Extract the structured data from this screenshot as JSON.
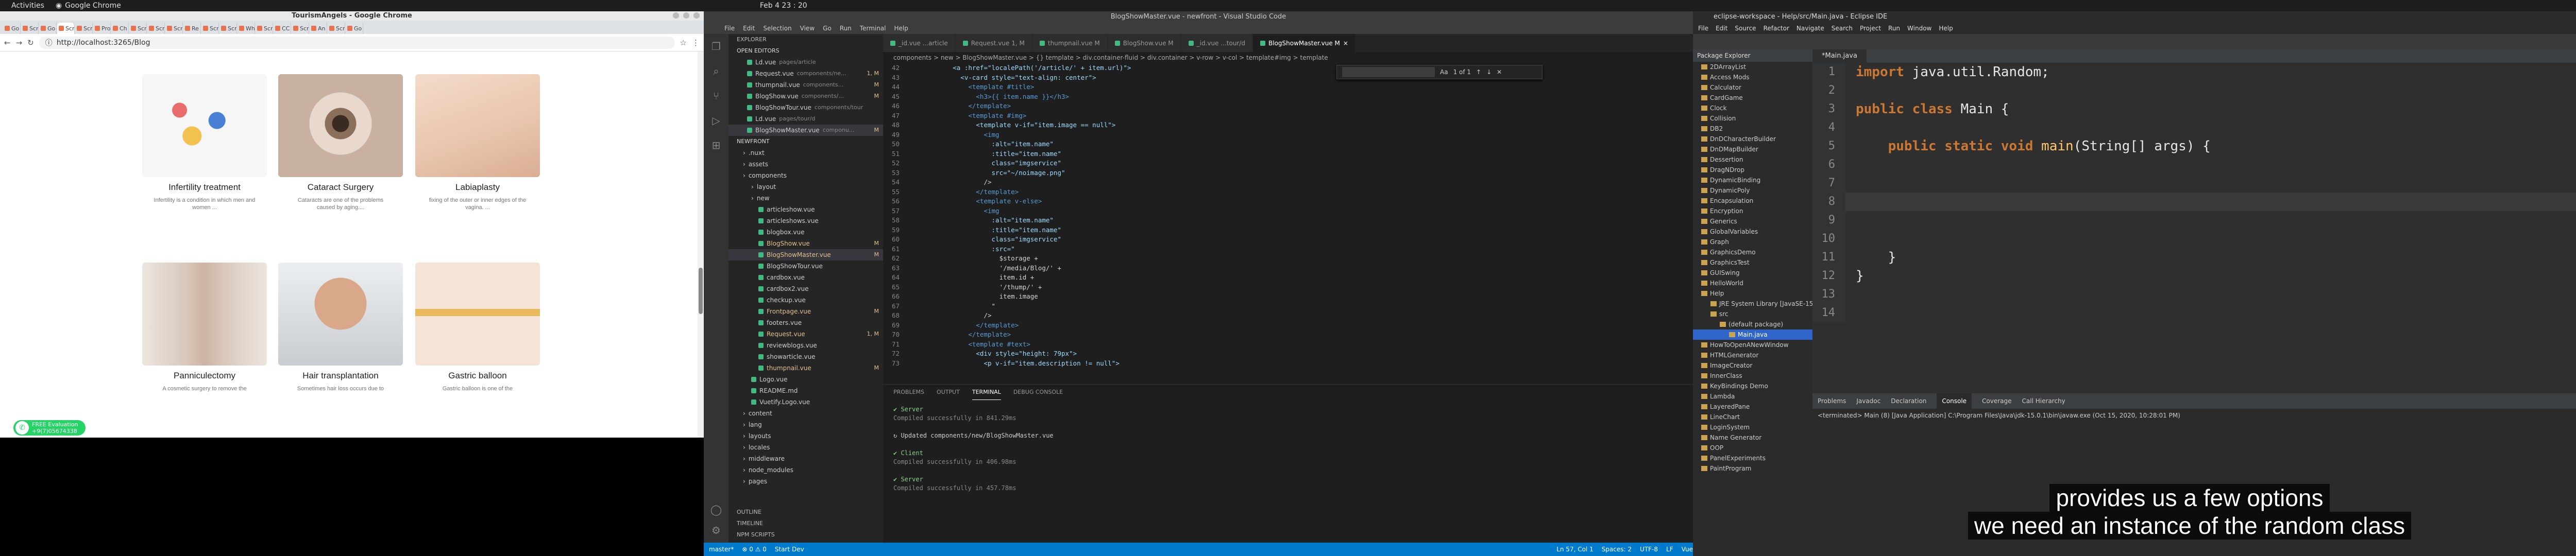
{
  "system_bar": {
    "activities": "Activities",
    "app": "Google Chrome",
    "clock": "Feb 4 23 : 20"
  },
  "chrome": {
    "window_title": "TourismAngels - Google Chrome",
    "tabs": [
      "Go",
      "Scr",
      "Go",
      "Scr",
      "Scr",
      "Pro",
      "Ch",
      "Scr",
      "Scr",
      "Scr",
      "Re",
      "Scr",
      "Scr",
      "Wh",
      "Scr",
      "CC",
      "Scr",
      "An",
      "Scr",
      "Go"
    ],
    "active_tab_index": 3,
    "url": "http://localhost:3265/Blog",
    "cards": [
      {
        "title": "Infertility treatment",
        "desc": "Infertility is a condition in which men and women ...",
        "img": "pills"
      },
      {
        "title": "Cataract Surgery",
        "desc": "Cataracts are one of the problems caused by aging....",
        "img": "eye"
      },
      {
        "title": "Labiaplasty",
        "desc": "fixing of the outer or inner edges of the vagina. ...",
        "img": "skin"
      },
      {
        "title": "Panniculectomy",
        "desc": "A cosmetic surgery to remove the",
        "img": "waist"
      },
      {
        "title": "Hair transplantation",
        "desc": "Sometimes hair loss occurs due to",
        "img": "man"
      },
      {
        "title": "Gastric balloon",
        "desc": "Gastric balloon is one of the",
        "img": "tape"
      }
    ],
    "whatsapp": {
      "line1": "FREE Evaluation",
      "line2": "+9(7)05674338"
    }
  },
  "vscode": {
    "window_title": "BlogShowMaster.vue - newfront - Visual Studio Code",
    "menu": [
      "File",
      "Edit",
      "Selection",
      "View",
      "Go",
      "Run",
      "Terminal",
      "Help"
    ],
    "sidebar": {
      "explorer_label": "EXPLORER",
      "open_editors_label": "OPEN EDITORS",
      "open_editors": [
        {
          "name": "Ld.vue",
          "path": "pages/article",
          "mod": ""
        },
        {
          "name": "Request.vue",
          "path": "components/ne...",
          "mod": "1, M"
        },
        {
          "name": "thumpnail.vue",
          "path": "components...",
          "mod": "M"
        },
        {
          "name": "BlogShow.vue",
          "path": "components/...",
          "mod": "M"
        },
        {
          "name": "BlogShowTour.vue",
          "path": "components/tour",
          "mod": ""
        },
        {
          "name": "Ld.vue",
          "path": "pages/tour/d",
          "mod": ""
        },
        {
          "name": "BlogShowMaster.vue",
          "path": "componu...",
          "mod": "M"
        }
      ],
      "project_label": "NEWFRONT",
      "tree": [
        {
          "name": ".nuxt",
          "mod": ""
        },
        {
          "name": "assets",
          "mod": ""
        },
        {
          "name": "components",
          "mod": ""
        },
        {
          "name": "layout",
          "mod": ""
        },
        {
          "name": "new",
          "mod": ""
        },
        {
          "name": "articleshow.vue",
          "mod": ""
        },
        {
          "name": "articleshows.vue",
          "mod": ""
        },
        {
          "name": "blogbox.vue",
          "mod": ""
        },
        {
          "name": "BlogShow.vue",
          "mod": "M"
        },
        {
          "name": "BlogShowMaster.vue",
          "mod": "M"
        },
        {
          "name": "BlogShowTour.vue",
          "mod": ""
        },
        {
          "name": "cardbox.vue",
          "mod": ""
        },
        {
          "name": "cardbox2.vue",
          "mod": ""
        },
        {
          "name": "checkup.vue",
          "mod": ""
        },
        {
          "name": "Frontpage.vue",
          "mod": "M"
        },
        {
          "name": "footers.vue",
          "mod": ""
        },
        {
          "name": "Request.vue",
          "mod": "1, M"
        },
        {
          "name": "reviewblogs.vue",
          "mod": ""
        },
        {
          "name": "showarticle.vue",
          "mod": ""
        },
        {
          "name": "thumpnail.vue",
          "mod": "M"
        },
        {
          "name": "Logo.vue",
          "mod": ""
        },
        {
          "name": "README.md",
          "mod": ""
        },
        {
          "name": "Vuetify.Logo.vue",
          "mod": ""
        },
        {
          "name": "content",
          "mod": ""
        },
        {
          "name": "lang",
          "mod": ""
        },
        {
          "name": "layouts",
          "mod": ""
        },
        {
          "name": "locales",
          "mod": ""
        },
        {
          "name": "middleware",
          "mod": ""
        },
        {
          "name": "node_modules",
          "mod": ""
        },
        {
          "name": "pages",
          "mod": ""
        }
      ],
      "outline_label": "OUTLINE",
      "timeline_label": "TIMELINE",
      "npm_label": "NPM SCRIPTS"
    },
    "tabs": [
      {
        "name": "_id.vue ...article",
        "active": false
      },
      {
        "name": "Request.vue 1, M",
        "active": false
      },
      {
        "name": "thumpnail.vue M",
        "active": false
      },
      {
        "name": "BlogShow.vue M",
        "active": false
      },
      {
        "name": "_id.vue ...tour/d",
        "active": false
      },
      {
        "name": "BlogShowMaster.vue M",
        "active": true
      }
    ],
    "breadcrumb": "components > new > BlogShowMaster.vue > {} template > div.container-fluid > div.container > v-row > v-col > template#img > template",
    "find_value": "Aa",
    "find_count": "1 of 1",
    "code_lines": [
      {
        "n": "42",
        "t": "          <a :href=\"localePath('/article/' + item.url)\">"
      },
      {
        "n": "43",
        "t": "            <v-card style=\"text-align: center\">"
      },
      {
        "n": "44",
        "t": "              <template #title>"
      },
      {
        "n": "45",
        "t": "                <h3>{{ item.name }}</h3>"
      },
      {
        "n": "46",
        "t": "              </template>"
      },
      {
        "n": "47",
        "t": "              <template #img>"
      },
      {
        "n": "48",
        "t": "                <template v-if=\"item.image == null\">"
      },
      {
        "n": "49",
        "t": "                  <img"
      },
      {
        "n": "50",
        "t": "                    :alt=\"item.name\""
      },
      {
        "n": "51",
        "t": "                    :title=\"item.name\""
      },
      {
        "n": "52",
        "t": "                    class=\"imgservice\""
      },
      {
        "n": "53",
        "t": "                    src=\"~/noimage.png\""
      },
      {
        "n": "54",
        "t": "                  />"
      },
      {
        "n": "55",
        "t": "                </template>"
      },
      {
        "n": "56",
        "t": "                <template v-else>"
      },
      {
        "n": "57",
        "t": "                  <img"
      },
      {
        "n": "58",
        "t": "                    :alt=\"item.name\""
      },
      {
        "n": "59",
        "t": "                    :title=\"item.name\""
      },
      {
        "n": "60",
        "t": "                    class=\"imgservice\""
      },
      {
        "n": "61",
        "t": "                    :src=\""
      },
      {
        "n": "62",
        "t": "                      $storage +"
      },
      {
        "n": "63",
        "t": "                      '/media/Blog/' +"
      },
      {
        "n": "64",
        "t": "                      item.id +"
      },
      {
        "n": "65",
        "t": "                      '/thump/' +"
      },
      {
        "n": "66",
        "t": "                      item.image"
      },
      {
        "n": "67",
        "t": "                    \""
      },
      {
        "n": "68",
        "t": "                  />"
      },
      {
        "n": "69",
        "t": "                </template>"
      },
      {
        "n": "70",
        "t": "              </template>"
      },
      {
        "n": "71",
        "t": "              <template #text>"
      },
      {
        "n": "72",
        "t": "                <div style=\"height: 79px\">"
      },
      {
        "n": "73",
        "t": "                  <p v-if=\"item.description != null\">"
      }
    ],
    "panel_tabs": [
      "PROBLEMS",
      "OUTPUT",
      "TERMINAL",
      "DEBUG CONSOLE"
    ],
    "active_panel": "TERMINAL",
    "terminal": [
      {
        "t": "✔ Server",
        "c": "#89d185"
      },
      {
        "t": "  Compiled successfully in 841.29ms",
        "c": "#888"
      },
      {
        "t": "",
        "c": "#ccc"
      },
      {
        "t": "↻ Updated components/new/BlogShowMaster.vue",
        "c": "#ccc"
      },
      {
        "t": "",
        "c": "#ccc"
      },
      {
        "t": "✔ Client",
        "c": "#89d185"
      },
      {
        "t": "  Compiled successfully in 406.98ms",
        "c": "#888"
      },
      {
        "t": "",
        "c": "#ccc"
      },
      {
        "t": "✔ Server",
        "c": "#89d185"
      },
      {
        "t": "  Compiled successfully in 457.78ms",
        "c": "#888"
      }
    ],
    "status_left": [
      "master*",
      "⊗ 0 ⚠ 0",
      "Start Dev"
    ],
    "status_right": [
      "Ln 57, Col 1",
      "Spaces: 2",
      "UTF-8",
      "LF",
      "Vue"
    ]
  },
  "eclipse": {
    "window_title": "eclipse-workspace - Help/src/Main.java - Eclipse IDE",
    "menu": [
      "File",
      "Edit",
      "Source",
      "Refactor",
      "Navigate",
      "Search",
      "Project",
      "Run",
      "Window",
      "Help"
    ],
    "explorer_title": "Package Explorer",
    "projects": [
      "2DArrayList",
      "Access Mods",
      "Calculator",
      "CardGame",
      "Clock",
      "Collision",
      "DB2",
      "DnDCharacterBuilder",
      "DnDMapBuilder",
      "Dessertion",
      "DragNDrop",
      "DynamicBinding",
      "DynamicPoly",
      "Encapsulation",
      "Encryption",
      "Generics",
      "GlobalVariables",
      "Graph",
      "GraphicsDemo",
      "GraphicsTest",
      "GUISwing",
      "HelloWorld",
      "Help",
      "JRE System Library [JavaSE-15]",
      "src",
      "(default package)",
      "Main.java",
      "HowToOpenANewWindow",
      "HTMLGenerator",
      "ImageCreator",
      "InnerClass",
      "KeyBindings Demo",
      "Lambda",
      "LayeredPane",
      "LineChart",
      "LoginSystem",
      "Name Generator",
      "OOP",
      "PanelExperiments",
      "PaintProgram"
    ],
    "selected_project": "Main.java",
    "editor_tab": "*Main.java",
    "code": [
      {
        "n": "1",
        "tokens": [
          [
            "kw",
            "import "
          ],
          [
            "ty",
            "java.util.Random;"
          ]
        ]
      },
      {
        "n": "2",
        "tokens": []
      },
      {
        "n": "3",
        "tokens": [
          [
            "kw",
            "public class "
          ],
          [
            "ty",
            "Main {"
          ]
        ]
      },
      {
        "n": "4",
        "tokens": []
      },
      {
        "n": "5",
        "tokens": [
          [
            "ty",
            "    "
          ],
          [
            "kw",
            "public static void "
          ],
          [
            "mt",
            "main"
          ],
          [
            "ty",
            "(String[] args) {"
          ]
        ]
      },
      {
        "n": "6",
        "tokens": []
      },
      {
        "n": "7",
        "tokens": []
      },
      {
        "n": "8",
        "tokens": []
      },
      {
        "n": "9",
        "tokens": []
      },
      {
        "n": "10",
        "tokens": []
      },
      {
        "n": "11",
        "tokens": [
          [
            "ty",
            "    }"
          ]
        ]
      },
      {
        "n": "12",
        "tokens": [
          [
            "ty",
            "}"
          ]
        ]
      },
      {
        "n": "13",
        "tokens": []
      },
      {
        "n": "14",
        "tokens": []
      }
    ],
    "console_tabs": [
      "Problems",
      "Javadoc",
      "Declaration",
      "Console",
      "Coverage",
      "Call Hierarchy"
    ],
    "active_console_tab": "Console",
    "console_text": "<terminated> Main (8) [Java Application] C:\\Program Files\\Java\\jdk-15.0.1\\bin\\javaw.exe (Oct 15, 2020, 10:28:01 PM)"
  },
  "subtitles": {
    "line1": "provides us a few options",
    "line2": "we need an instance of the random class"
  }
}
